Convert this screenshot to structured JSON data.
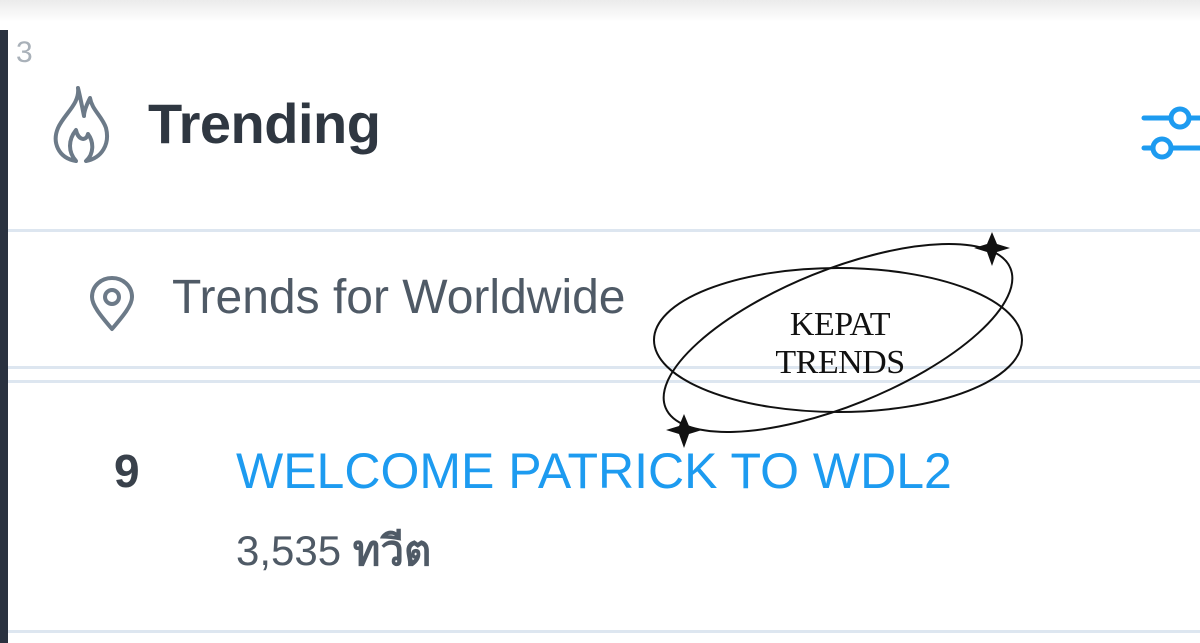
{
  "corner_number": "3",
  "header": {
    "title": "Trending",
    "icon": "flame-icon",
    "settings_icon": "settings-sliders-icon"
  },
  "location": {
    "label": "Trends for Worldwide",
    "icon": "location-pin-icon"
  },
  "trends": [
    {
      "rank": "9",
      "name": "WELCOME PATRICK TO WDL2",
      "count": "3,535",
      "count_unit": "ทวีต"
    }
  ],
  "watermark": {
    "line1": "KEPAT",
    "line2": "TRENDS"
  },
  "colors": {
    "accent": "#1d9bf0",
    "title_text": "#2f3741",
    "secondary_text": "#4f5a66",
    "divider": "#dde6f0",
    "icon_gray": "#6c7a88"
  }
}
